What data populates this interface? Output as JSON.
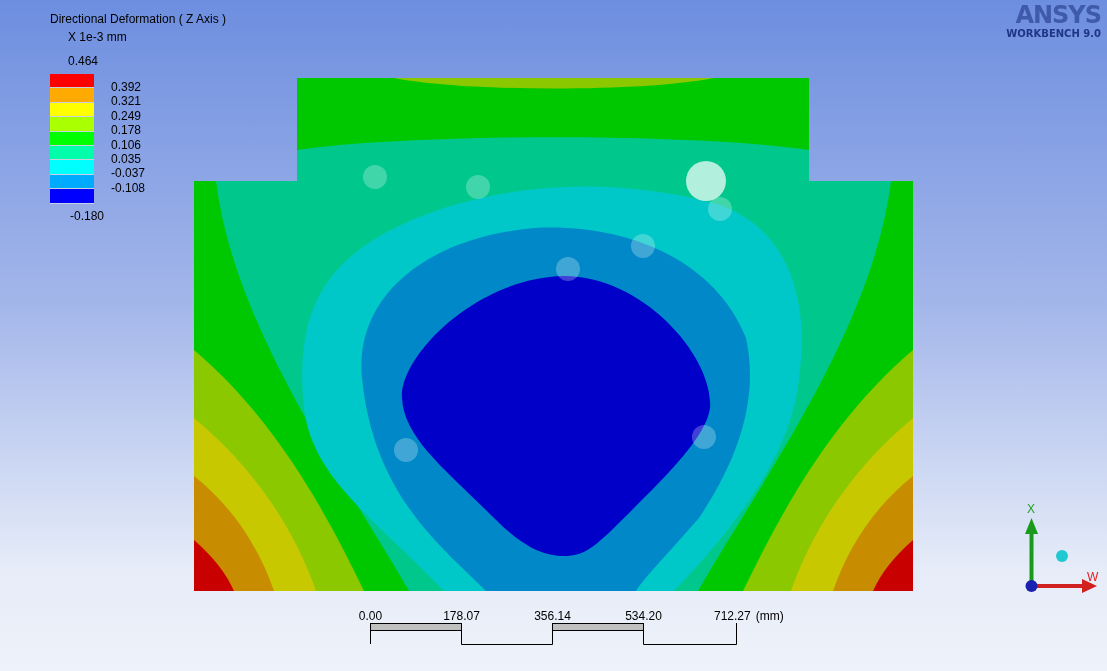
{
  "legend": {
    "title": "Directional Deformation ( Z Axis )",
    "unit": "X 1e-3 mm",
    "max": "0.464",
    "min": "-0.180",
    "bands": [
      {
        "color": "#ff0000"
      },
      {
        "color": "#ffaa00"
      },
      {
        "color": "#ffff00"
      },
      {
        "color": "#aaff00"
      },
      {
        "color": "#00ff00"
      },
      {
        "color": "#00ffaa"
      },
      {
        "color": "#00ffff"
      },
      {
        "color": "#00aaff"
      },
      {
        "color": "#0000ff"
      }
    ],
    "ticks": [
      "0.392",
      "0.321",
      "0.249",
      "0.178",
      "0.106",
      "0.035",
      "-0.037",
      "-0.108"
    ]
  },
  "logo": {
    "name": "ANSYS",
    "product": "WORKBENCH 9.0"
  },
  "scale": {
    "ticks": [
      "0.00",
      "178.07",
      "356.14",
      "534.20",
      "712.27"
    ],
    "unit": "(mm)"
  },
  "triad": {
    "up": "X",
    "right": "W"
  }
}
